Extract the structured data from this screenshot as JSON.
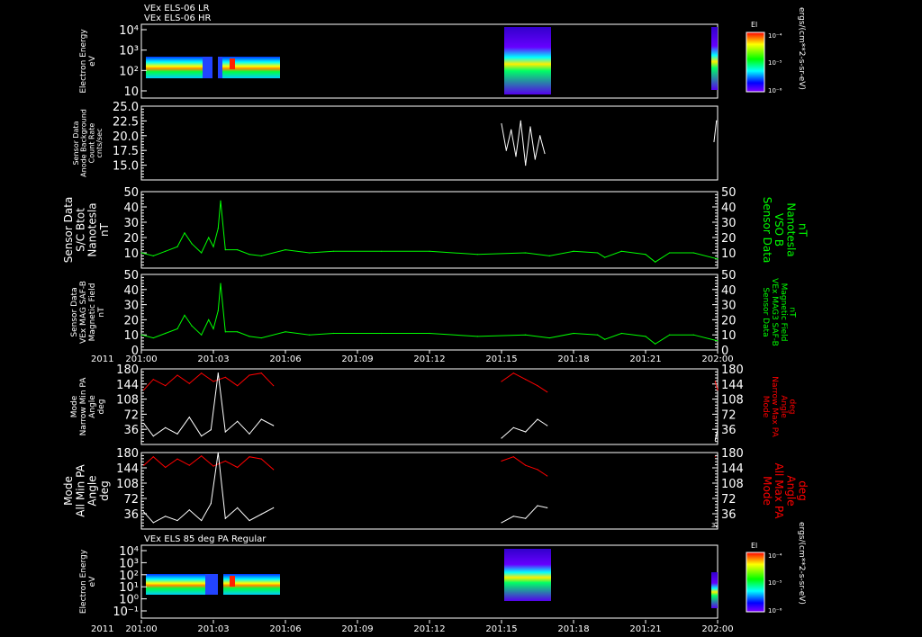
{
  "header": {
    "line1": "VEx ELS-06 LR",
    "line2": "VEx ELS-06 HR"
  },
  "spectro_header": "VEx ELS 85 deg PA Regular",
  "colorbar": {
    "title": "El",
    "unit": "ergs/(cm**2-s-sr-eV)",
    "ticks": [
      "10⁻⁴",
      "10⁻⁵",
      "10⁻⁶"
    ],
    "colors": [
      "#ff0000",
      "#ff7f00",
      "#ffff00",
      "#00ff00",
      "#00ffff",
      "#0000ff",
      "#7f00ff"
    ]
  },
  "colors": {
    "white": "#ffffff",
    "green": "#00ff00",
    "red": "#ff0000",
    "background": "#000000"
  },
  "time_axis": {
    "year": "2011",
    "ticks": [
      "201:00",
      "201:03",
      "201:06",
      "201:09",
      "201:12",
      "201:15",
      "201:18",
      "201:21",
      "202:00"
    ]
  },
  "chart_data": [
    {
      "type": "heatmap",
      "ylabel": [
        "Electron Energy",
        "eV"
      ],
      "yscale": "log",
      "yticks": [
        "10⁴",
        "10³",
        "10²",
        "10"
      ],
      "data_coverage_hours": [
        [
          0,
          5.6
        ],
        [
          15,
          17
        ],
        [
          23.8,
          24
        ]
      ]
    },
    {
      "type": "line",
      "ylabel": [
        "Sensor Data",
        "Anode Background",
        "Count Rate",
        "cnts/sec"
      ],
      "ylim": [
        12.5,
        25
      ],
      "yticks": [
        "25.0",
        "22.5",
        "20.0",
        "17.5",
        "15.0"
      ],
      "series": [
        {
          "color": "#ffffff",
          "x": [
            15.0,
            15.2,
            15.4,
            15.6,
            15.8,
            16.0,
            16.2,
            16.4,
            16.6,
            16.8,
            23.85,
            23.95
          ],
          "y": [
            22.0,
            17.5,
            21.0,
            16.5,
            22.5,
            15.0,
            21.5,
            16.0,
            20.0,
            17.0,
            19.0,
            22.5
          ]
        }
      ]
    },
    {
      "type": "line",
      "ylabel": [
        "Sensor Data",
        "S/C Btot",
        "Nanotesla",
        "nT"
      ],
      "ylabel_right": [
        "Sensor Data",
        "VSO B",
        "Nanotesla",
        "nT"
      ],
      "ylim": [
        0,
        50
      ],
      "yticks": [
        "50",
        "40",
        "30",
        "20",
        "10"
      ],
      "series": [
        {
          "color": "#00ff00",
          "x": [
            0,
            0.5,
            1.0,
            1.5,
            1.8,
            2.1,
            2.5,
            2.8,
            3.0,
            3.2,
            3.3,
            3.5,
            4.0,
            4.5,
            5.0,
            6.0,
            7.0,
            8.0,
            10.0,
            12.0,
            14.0,
            16.0,
            17.0,
            18.0,
            19.0,
            19.3,
            20.0,
            21.0,
            21.4,
            22.0,
            23.0,
            24.0
          ],
          "y": [
            10,
            8,
            11,
            14,
            23,
            16,
            10,
            20,
            14,
            26,
            44,
            12,
            12,
            9,
            8,
            12,
            10,
            11,
            11,
            11,
            9,
            10,
            8,
            11,
            10,
            7,
            11,
            9,
            4,
            10,
            10,
            6
          ]
        }
      ]
    },
    {
      "type": "line",
      "ylabel": [
        "Sensor Data",
        "VEx MAG SAF-B",
        "Magnetic Field",
        "nT"
      ],
      "ylabel_right": [
        "Sensor Data",
        "VEx MAG3 SAF-B",
        "Magnetic Field",
        "nT"
      ],
      "ylim": [
        0,
        50
      ],
      "yticks": [
        "50",
        "40",
        "30",
        "20",
        "10",
        "0"
      ],
      "series": [
        {
          "color": "#00ff00",
          "x": [
            0,
            0.5,
            1.0,
            1.5,
            1.8,
            2.1,
            2.5,
            2.8,
            3.0,
            3.2,
            3.3,
            3.5,
            4.0,
            4.5,
            5.0,
            6.0,
            7.0,
            8.0,
            10.0,
            12.0,
            14.0,
            16.0,
            17.0,
            18.0,
            19.0,
            19.3,
            20.0,
            21.0,
            21.4,
            22.0,
            23.0,
            24.0
          ],
          "y": [
            10,
            8,
            11,
            14,
            23,
            16,
            10,
            20,
            14,
            26,
            44,
            12,
            12,
            9,
            8,
            12,
            10,
            11,
            11,
            11,
            9,
            10,
            8,
            11,
            10,
            7,
            11,
            9,
            4,
            10,
            10,
            6
          ]
        }
      ]
    },
    {
      "type": "line",
      "ylabel": [
        "Mode",
        "Narrow Min PA",
        "Angle",
        "deg"
      ],
      "ylabel_right": [
        "Mode",
        "Narrow Max PA",
        "Angle",
        "deg"
      ],
      "ylim": [
        0,
        180
      ],
      "yticks": [
        "180",
        "144",
        "108",
        "72",
        "36"
      ],
      "series": [
        {
          "name": "Max PA",
          "color": "#ff0000",
          "x": [
            0.1,
            0.5,
            1.0,
            1.5,
            2.0,
            2.5,
            3.0,
            3.5,
            4.0,
            4.5,
            5.0,
            5.5,
            15.0,
            15.5,
            16.0,
            16.5,
            16.9,
            23.9,
            24.0
          ],
          "y": [
            130,
            155,
            140,
            165,
            145,
            170,
            150,
            160,
            140,
            165,
            170,
            140,
            150,
            170,
            155,
            140,
            125,
            150,
            130
          ]
        },
        {
          "name": "Min PA",
          "color": "#ffffff",
          "x": [
            0.1,
            0.5,
            1.0,
            1.5,
            2.0,
            2.5,
            2.9,
            3.2,
            3.5,
            4.0,
            4.5,
            5.0,
            5.5,
            15.0,
            15.5,
            16.0,
            16.5,
            16.9,
            23.9,
            24.0
          ],
          "y": [
            50,
            20,
            40,
            25,
            65,
            20,
            35,
            170,
            30,
            55,
            25,
            60,
            45,
            15,
            40,
            30,
            60,
            45,
            10,
            35
          ]
        }
      ]
    },
    {
      "type": "line",
      "ylabel": [
        "Mode",
        "All Min PA",
        "Angle",
        "deg"
      ],
      "ylabel_right": [
        "Mode",
        "All Max PA",
        "Angle",
        "deg"
      ],
      "ylim": [
        0,
        180
      ],
      "yticks": [
        "180",
        "144",
        "108",
        "72",
        "36"
      ],
      "series": [
        {
          "name": "Max PA",
          "color": "#ff0000",
          "x": [
            0.1,
            0.5,
            1.0,
            1.5,
            2.0,
            2.5,
            3.0,
            3.5,
            4.0,
            4.5,
            5.0,
            5.5,
            15.0,
            15.5,
            16.0,
            16.5,
            16.9,
            23.9
          ],
          "y": [
            150,
            170,
            145,
            165,
            150,
            172,
            148,
            160,
            145,
            170,
            165,
            140,
            160,
            170,
            150,
            140,
            125,
            170
          ]
        },
        {
          "name": "Min PA",
          "color": "#ffffff",
          "x": [
            0.1,
            0.5,
            1.0,
            1.5,
            2.0,
            2.5,
            2.9,
            3.2,
            3.5,
            4.0,
            4.5,
            5.0,
            5.5,
            15.0,
            15.5,
            16.0,
            16.5,
            16.9,
            23.95
          ],
          "y": [
            40,
            15,
            30,
            20,
            45,
            20,
            60,
            180,
            25,
            50,
            20,
            35,
            50,
            15,
            30,
            25,
            55,
            50,
            5
          ]
        }
      ]
    },
    {
      "type": "heatmap",
      "ylabel": [
        "Electron Energy",
        "eV"
      ],
      "yscale": "log",
      "yticks": [
        "10⁴",
        "10³",
        "10²",
        "10¹",
        "10⁰",
        "10⁻¹"
      ],
      "data_coverage_hours": [
        [
          0,
          5.6
        ],
        [
          15,
          17
        ],
        [
          23.8,
          24
        ]
      ]
    }
  ]
}
